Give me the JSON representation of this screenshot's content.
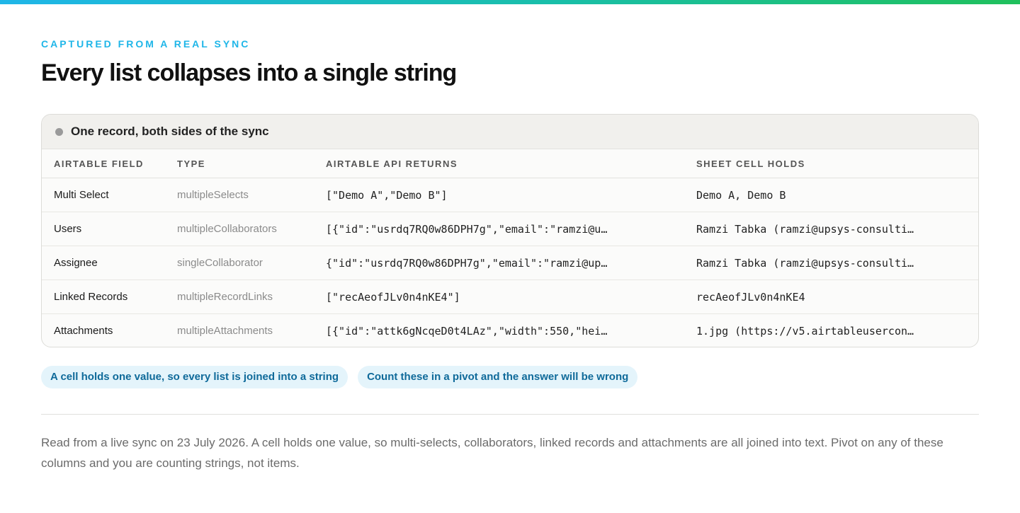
{
  "eyebrow": "CAPTURED FROM A REAL SYNC",
  "title": "Every list collapses into a single string",
  "card": {
    "title": "One record, both sides of the sync",
    "columns": [
      "AIRTABLE FIELD",
      "TYPE",
      "AIRTABLE API RETURNS",
      "SHEET CELL HOLDS"
    ],
    "rows": [
      {
        "field": "Multi Select",
        "type": "multipleSelects",
        "api": "[\"Demo A\",\"Demo B\"]",
        "sheet": "Demo A, Demo B"
      },
      {
        "field": "Users",
        "type": "multipleCollaborators",
        "api": "[{\"id\":\"usrdq7RQ0w86DPH7g\",\"email\":\"ramzi@u…",
        "sheet": "Ramzi Tabka (ramzi@upsys-consulti…"
      },
      {
        "field": "Assignee",
        "type": "singleCollaborator",
        "api": "{\"id\":\"usrdq7RQ0w86DPH7g\",\"email\":\"ramzi@up…",
        "sheet": "Ramzi Tabka (ramzi@upsys-consulti…"
      },
      {
        "field": "Linked Records",
        "type": "multipleRecordLinks",
        "api": "[\"recAeofJLv0n4nKE4\"]",
        "sheet": "recAeofJLv0n4nKE4"
      },
      {
        "field": "Attachments",
        "type": "multipleAttachments",
        "api": "[{\"id\":\"attk6gNcqeD0t4LAz\",\"width\":550,\"hei…",
        "sheet": "1.jpg (https://v5.airtableusercon…"
      }
    ]
  },
  "pills": [
    "A cell holds one value, so every list is joined into a string",
    "Count these in a pivot and the answer will be wrong"
  ],
  "footnote": "Read from a live sync on 23 July 2026. A cell holds one value, so multi-selects, collaborators, linked records and attachments are all joined into text. Pivot on any of these columns and you are counting strings, not items.",
  "colors": {
    "accent_start": "#1fb6e8",
    "accent_end": "#20c05c",
    "pill_bg": "#e4f4fb",
    "pill_text": "#0f6a9a"
  }
}
